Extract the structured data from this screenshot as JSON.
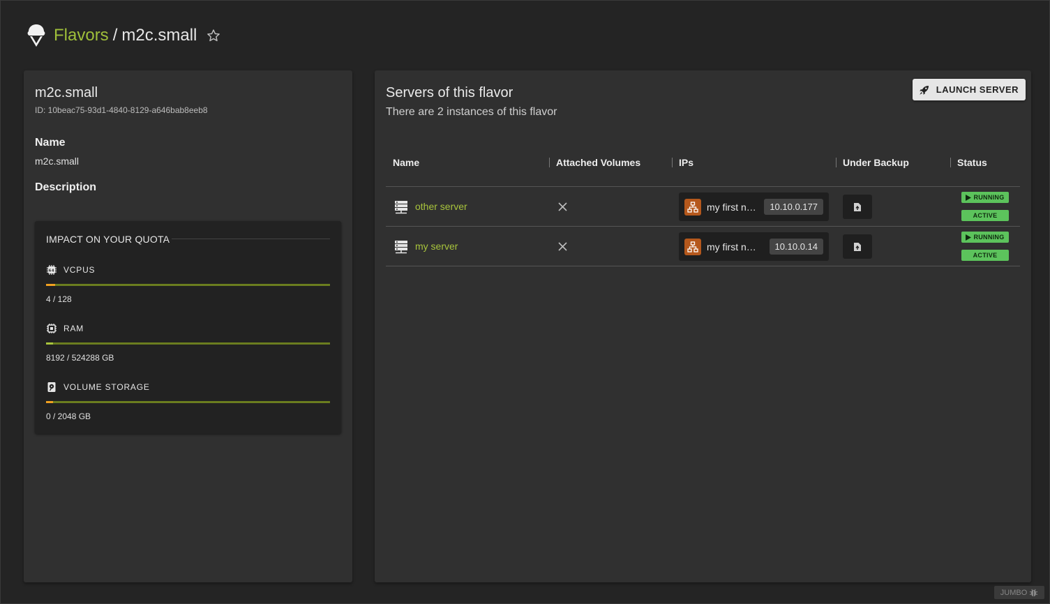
{
  "header": {
    "logo_icon": "ice-cream-icon",
    "breadcrumb_parent": "Flavors",
    "breadcrumb_separator": "/",
    "breadcrumb_current": "m2c.small",
    "favorite_icon": "star-outline-icon"
  },
  "flavor": {
    "title": "m2c.small",
    "id_text": "ID: 10beac75-93d1-4840-8129-a646bab8eeb8",
    "name_label": "Name",
    "name_value": "m2c.small",
    "description_label": "Description",
    "description_value": ""
  },
  "quota": {
    "title": "IMPACT ON YOUR QUOTA",
    "items": [
      {
        "icon": "cpu-icon",
        "label": "VCPUS",
        "value_text": "4 / 128",
        "used": 4,
        "total": 128
      },
      {
        "icon": "memory-icon",
        "label": "RAM",
        "value_text": "8192 / 524288 GB",
        "used": 8192,
        "total": 524288
      },
      {
        "icon": "hard-disk-icon",
        "label": "VOLUME STORAGE",
        "value_text": "0 / 2048 GB",
        "used": 0,
        "total": 2048
      }
    ]
  },
  "servers_panel": {
    "title": "Servers of this flavor",
    "subtitle": "There are 2 instances of this flavor",
    "launch_label": "LAUNCH SERVER",
    "columns": [
      "Name",
      "Attached Volumes",
      "IPs",
      "Under Backup",
      "Status"
    ],
    "rows": [
      {
        "name": "other server",
        "attached_volumes": "none",
        "network": "my first n…",
        "ip": "10.10.0.177",
        "status": "RUNNING",
        "state": "ACTIVE"
      },
      {
        "name": "my server",
        "attached_volumes": "none",
        "network": "my first ne…",
        "ip": "10.10.0.14",
        "status": "RUNNING",
        "state": "ACTIVE"
      }
    ]
  },
  "footer": {
    "badge": "JUMBO",
    "badge_icon": "bug-icon"
  },
  "colors": {
    "accent": "#9fbf3a",
    "link": "#a8c43c",
    "status_green": "#5cc35c",
    "network_orange": "#b5581c",
    "quota_fill": "#f0a020"
  }
}
